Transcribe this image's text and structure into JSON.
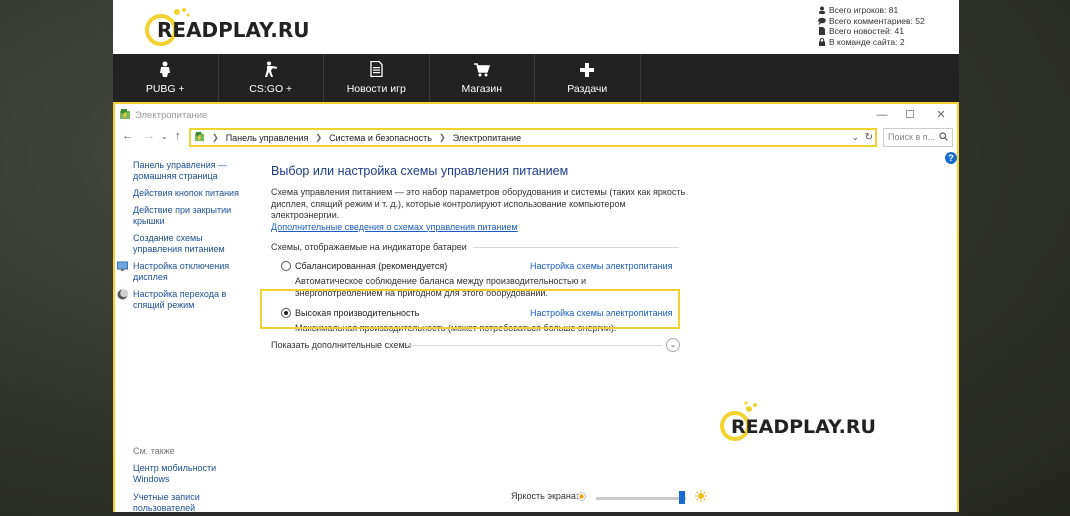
{
  "site": {
    "logo_text": "READPLAY.RU",
    "stats": [
      {
        "icon": "user-icon",
        "text": "Всего игроков: 81"
      },
      {
        "icon": "comment-icon",
        "text": "Всего комментариев: 52"
      },
      {
        "icon": "file-icon",
        "text": "Всего новостей: 41"
      },
      {
        "icon": "lock-icon",
        "text": "В команде сайта: 2"
      }
    ],
    "nav": [
      {
        "label": "PUBG +",
        "icon": "soldier-icon"
      },
      {
        "label": "CS:GO +",
        "icon": "gunner-icon"
      },
      {
        "label": "Новости игр",
        "icon": "document-icon"
      },
      {
        "label": "Магазин",
        "icon": "cart-icon"
      },
      {
        "label": "Раздачи",
        "icon": "plus-icon"
      }
    ]
  },
  "window": {
    "title": "Электропитание",
    "breadcrumbs": [
      "Панель управления",
      "Система и безопасность",
      "Электропитание"
    ],
    "search_placeholder": "Поиск в п...",
    "help": "?",
    "sidebar": {
      "links": [
        "Панель управления — домашняя страница",
        "Действия кнопок питания",
        "Действие при закрытии крышки",
        "Создание схемы управления питанием",
        "Настройка отключения дисплея",
        "Настройка перехода в спящий режим"
      ],
      "see_also_label": "См. также",
      "see_also": [
        "Центр мобильности Windows",
        "Учетные записи пользователей"
      ]
    },
    "main": {
      "title": "Выбор или настройка схемы управления питанием",
      "description": "Схема управления питанием — это набор параметров оборудования и системы (таких как яркость дисплея, спящий режим и т. д.), которые контролируют использование компьютером электроэнергии.",
      "more_link": "Дополнительные сведения о схемах управления питанием",
      "section_label": "Схемы, отображаемые на индикаторе батареи",
      "plans": [
        {
          "name": "Сбалансированная (рекомендуется)",
          "config_link": "Настройка схемы электропитания",
          "description": "Автоматическое соблюдение баланса между производительностью и энергопотреблением на пригодном для этого оборудовании.",
          "selected": false
        },
        {
          "name": "Высокая производительность",
          "config_link": "Настройка схемы электропитания",
          "description": "Максимальная производительность (может потребоваться больше энергии).",
          "selected": true
        }
      ],
      "show_more": "Показать дополнительные схемы"
    },
    "brightness": {
      "label": "Яркость экрана:",
      "level": 0.95
    },
    "watermark": "READPLAY.RU"
  },
  "colors": {
    "accent_yellow": "#f0d330",
    "link_blue": "#1a5dbf",
    "title_blue": "#1e3c8c",
    "nav_bg": "#222222"
  }
}
